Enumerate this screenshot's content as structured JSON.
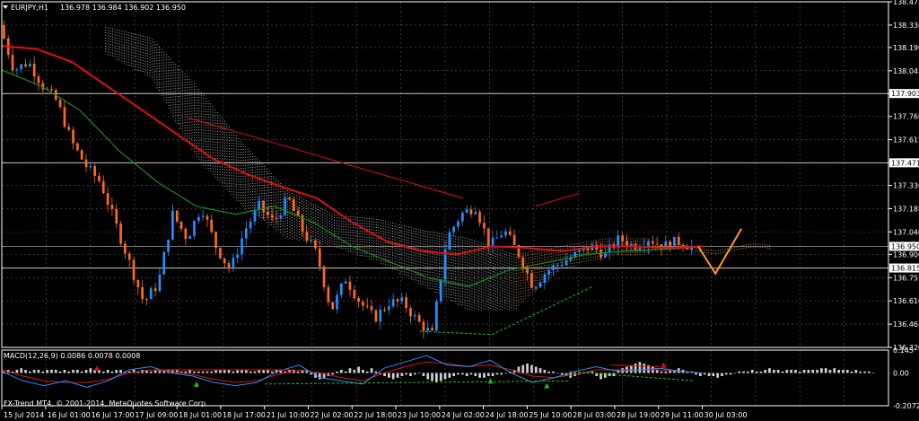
{
  "header": {
    "symbol_label": "EURJPY,H1",
    "ohlc_text": "136.978 136.984 136.902 136.950"
  },
  "indicator_header": "MACD(12,26,9) 0.0086 0.0078 0.0008",
  "footer_text": "FX-Trend MT4, © 2001-2014, MetaQuotes Software Corp.",
  "colors": {
    "background": "#000000",
    "grid": "#5a5a5a",
    "bull": "#1e90ff",
    "bear": "#ff6a1a",
    "ma_fast": "#e01010",
    "ma_slow": "#1a8a1a",
    "cloud": "#d8d8d8",
    "cloud_future": "#e7a070",
    "forecast": "#ff9a1f"
  },
  "chart_data": [
    {
      "type": "candlestick",
      "symbol": "EURJPY",
      "timeframe": "H1",
      "ylim": [
        136.32,
        138.475
      ],
      "y_ticks": [
        "138.475",
        "138.330",
        "138.190",
        "138.045",
        "137.903",
        "137.760",
        "137.615",
        "137.471",
        "137.330",
        "137.185",
        "137.040",
        "136.900",
        "136.755",
        "136.610",
        "136.465",
        "136.320"
      ],
      "x_labels": [
        "15 Jul 2014",
        "16 Jul 01:00",
        "16 Jul 17:00",
        "17 Jul 09:00",
        "18 Jul 01:00",
        "18 Jul 17:00",
        "21 Jul 10:00",
        "22 Jul 02:00",
        "22 Jul 18:00",
        "23 Jul 10:00",
        "24 Jul 02:00",
        "24 Jul 18:00",
        "25 Jul 10:00",
        "28 Jul 03:00",
        "28 Jul 19:00",
        "29 Jul 11:00",
        "30 Jul 03:00"
      ],
      "horizontal_levels": [
        {
          "price": 137.903,
          "label": "137.903"
        },
        {
          "price": 137.471,
          "label": "137.471"
        },
        {
          "price": 136.815,
          "label": "136.815"
        }
      ],
      "current_price": {
        "price": 136.95,
        "label": "136.950"
      },
      "price_path": [
        138.33,
        138.05,
        138.1,
        137.95,
        137.85,
        137.6,
        137.45,
        137.35,
        137.1,
        136.85,
        136.6,
        136.72,
        137.15,
        137.0,
        137.2,
        136.95,
        136.8,
        137.05,
        137.2,
        137.1,
        137.25,
        137.05,
        136.9,
        136.55,
        136.75,
        136.6,
        136.5,
        136.6,
        136.6,
        136.48,
        136.4,
        137.0,
        137.15,
        137.2,
        136.95,
        137.05,
        136.9,
        136.7,
        136.8,
        136.85,
        136.9,
        136.95,
        136.9,
        137.0,
        136.95,
        137.0,
        136.95,
        136.98,
        136.95
      ],
      "ma_fast_path": [
        138.2,
        138.18,
        138.1,
        137.95,
        137.8,
        137.65,
        137.5,
        137.4,
        137.32,
        137.25,
        137.1,
        136.98,
        136.92,
        136.9,
        136.95,
        136.94,
        136.92,
        136.95,
        136.95,
        136.94,
        136.95
      ],
      "ma_slow_path": [
        138.05,
        137.95,
        137.8,
        137.55,
        137.35,
        137.2,
        137.15,
        137.2,
        137.1,
        136.95,
        136.85,
        136.75,
        136.7,
        136.8,
        136.85,
        136.9,
        136.92,
        136.93,
        136.95
      ],
      "forecast_path": [
        136.95,
        136.78,
        137.06
      ],
      "trendlines": [
        {
          "color": "#e01010",
          "from": [
            137.75,
            13
          ],
          "to": [
            137.25,
            32
          ]
        },
        {
          "color": "#e01010",
          "from": [
            137.2,
            37
          ],
          "to": [
            137.28,
            40
          ]
        },
        {
          "color": "#17c017",
          "from": [
            136.42,
            29
          ],
          "to": [
            136.4,
            34
          ]
        },
        {
          "color": "#17c017",
          "from": [
            136.4,
            34
          ],
          "to": [
            136.7,
            41
          ]
        }
      ]
    },
    {
      "type": "bar",
      "name": "MACD(12,26,9)",
      "ylim": [
        -0.2072,
        0.145
      ],
      "y_ticks": [
        "0.145",
        "0.00",
        "-0.2072"
      ],
      "histogram": [
        0.01,
        0.02,
        0.01,
        0.02,
        0.03,
        0.02,
        0.01,
        0.02,
        0.02,
        0.01,
        0.02,
        0.02,
        0.02,
        0.01,
        0.02,
        0.01,
        0.02,
        0.02,
        0.01,
        0.02,
        0.03,
        0.02,
        0.02,
        0.01,
        0.02,
        0.01,
        0.02,
        0.02,
        0.01,
        0.01,
        0.02,
        0.01,
        0.02,
        0.02,
        0.01,
        0.02,
        0.02,
        0.01,
        0.02,
        0.02,
        0.02,
        0.01,
        0.01,
        0.02,
        0.01,
        0.01,
        0.01,
        0.01,
        0.01,
        0.02,
        0.02,
        0.02,
        0.02,
        0.01,
        0.02,
        0.02,
        0.02,
        0.01,
        0.01,
        0.02,
        0.02,
        0.02,
        0.01,
        0.02,
        0.02,
        0.01,
        0.02,
        0.02,
        0.01,
        0.02,
        0.02,
        -0.01,
        -0.03,
        -0.04,
        -0.03,
        -0.02,
        -0.01,
        0.01,
        0.02,
        0.01,
        0.03,
        0.02,
        0.04,
        0.02,
        0.01,
        0.03,
        0.01,
        -0.01,
        -0.02,
        -0.03,
        -0.04,
        -0.03,
        -0.02,
        -0.01,
        -0.02,
        -0.01,
        0.0,
        -0.02,
        -0.04,
        -0.05,
        -0.06,
        -0.05,
        -0.04,
        -0.03,
        -0.02,
        -0.01,
        -0.01,
        -0.02,
        -0.01,
        -0.02,
        -0.03,
        -0.03,
        -0.02,
        -0.02,
        -0.01,
        -0.01,
        0.0,
        0.01,
        0.02,
        0.04,
        0.05,
        0.06,
        0.05,
        0.04,
        0.03,
        0.02,
        0.01,
        0.01,
        0.0,
        -0.01,
        -0.02,
        -0.03,
        -0.02,
        -0.01,
        0.0,
        0.01,
        0.01,
        -0.02,
        -0.04,
        -0.03,
        -0.02,
        -0.02,
        0.02,
        0.03,
        0.04,
        0.05,
        0.06,
        0.07,
        0.06,
        0.05,
        0.04,
        0.02,
        0.01,
        0.01,
        0.02,
        0.02,
        0.03,
        0.02,
        0.01,
        0.01,
        -0.01,
        -0.02,
        -0.01,
        -0.02,
        -0.02,
        -0.03,
        -0.02,
        -0.01,
        -0.01,
        0.0,
        0.01,
        0.01,
        0.01,
        0.02,
        0.01,
        0.01,
        0.02,
        0.03,
        0.02,
        0.02,
        0.01,
        0.02,
        0.02,
        0.02,
        0.01,
        0.02,
        0.02,
        0.02,
        0.02,
        0.03,
        0.03,
        0.02,
        0.03,
        0.02,
        0.02,
        0.02,
        0.01,
        0.02,
        0.01,
        0.01,
        0.01,
        0.0
      ],
      "macd_path": [
        0.01,
        -0.05,
        -0.08,
        -0.05,
        -0.09,
        -0.05,
        0.02,
        0.04,
        0.0,
        -0.02,
        -0.06,
        -0.08,
        -0.06,
        0.01,
        0.05,
        -0.03,
        -0.05,
        -0.07,
        0.03,
        0.07,
        0.11,
        0.05,
        0.04,
        0.08,
        0.0,
        -0.06,
        -0.03,
        0.01,
        0.04,
        0.01,
        0.02,
        0.03,
        0.01,
        0.0
      ],
      "signal_path": [
        0.02,
        -0.02,
        -0.05,
        -0.06,
        -0.06,
        -0.04,
        0.0,
        0.02,
        0.01,
        -0.01,
        -0.04,
        -0.06,
        -0.05,
        -0.01,
        0.02,
        0.0,
        -0.03,
        -0.05,
        0.0,
        0.04,
        0.07,
        0.06,
        0.04,
        0.05,
        0.02,
        -0.02,
        -0.03,
        -0.01,
        0.02,
        0.02,
        0.02,
        0.02,
        0.01,
        0.0
      ],
      "divergence_lines": [
        {
          "color": "#e01010",
          "from": [
            0.02,
            22
          ],
          "to": [
            0.02,
            42
          ]
        },
        {
          "color": "#e01010",
          "from": [
            0.05,
            88
          ],
          "to": [
            0.04,
            95
          ]
        },
        {
          "color": "#17c017",
          "from": [
            -0.07,
            38
          ],
          "to": [
            -0.05,
            82
          ]
        },
        {
          "color": "#17c017",
          "from": [
            0.01,
            82
          ],
          "to": [
            -0.05,
            100
          ]
        }
      ]
    }
  ]
}
